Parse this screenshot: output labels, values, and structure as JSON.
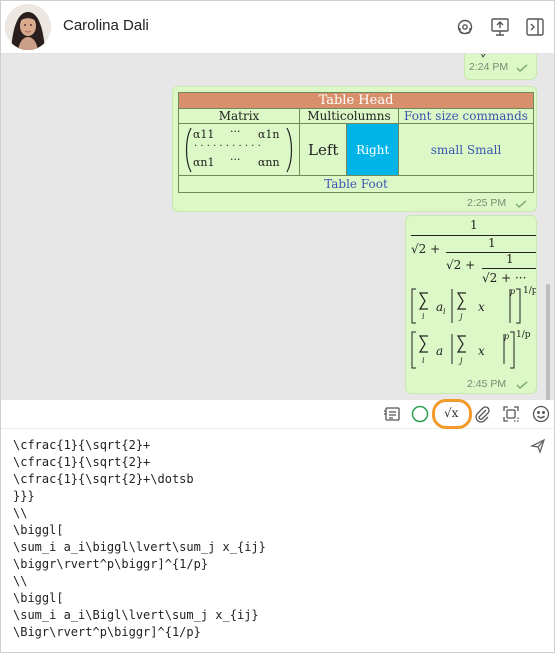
{
  "header": {
    "contact_name": "Carolina Dali",
    "icons": [
      "headset-icon",
      "screen-share-icon",
      "sidebar-toggle-icon"
    ]
  },
  "messages": [
    {
      "id": "msg-top-partial",
      "time": "2:24 PM"
    },
    {
      "id": "msg-table",
      "time": "2:25 PM",
      "table": {
        "head": "Table Head",
        "columns": [
          "Matrix",
          "Multicolumns",
          "Font size commands"
        ],
        "matrix": {
          "a11": "α11",
          "a1n": "α1n",
          "an1": "αn1",
          "ann": "αnn",
          "hdots": "···",
          "dots": "· · · · · · · · · · ·"
        },
        "left_label": "Left",
        "right_label": "Right",
        "font_sizes": "small Small",
        "foot": "Table Foot"
      }
    },
    {
      "id": "msg-math",
      "time": "2:45 PM",
      "fraction": {
        "one": "1",
        "sqrt2": "√2 +",
        "dots": "√2 + ···"
      },
      "sum_exp": "1/p",
      "sum_p": "p",
      "sum_sub_i": "i",
      "sum_sub_j": "j",
      "a_i": "a",
      "x_ij": "x"
    }
  ],
  "toolbar": {
    "icons": [
      "message-list-icon",
      "circle-icon",
      "sqrt-icon",
      "paperclip-icon",
      "screenshot-icon",
      "emoji-icon"
    ],
    "sqrt_label": "√x"
  },
  "editor": {
    "lines": [
      "\\cfrac{1}{\\sqrt{2}+",
      "\\cfrac{1}{\\sqrt{2}+",
      "\\cfrac{1}{\\sqrt{2}+\\dotsb",
      "}}}",
      "\\\\",
      "\\biggl[",
      "\\sum_i a_i\\biggl\\lvert\\sum_j x_{ij}",
      "\\biggr\\rvert^p\\biggr]^{1/p}",
      "\\\\",
      "\\biggl[",
      "\\sum_i a_i\\Bigl\\lvert\\sum_j x_{ij}",
      "\\Bigr\\rvert^p\\biggr]^{1/p}"
    ]
  },
  "colors": {
    "bubble": "#dcf8c6",
    "chat_bg": "#e7e7e7",
    "table_head": "#d98f6b",
    "right_cell": "#00b4e8",
    "highlight_ring": "#f39a2c"
  }
}
